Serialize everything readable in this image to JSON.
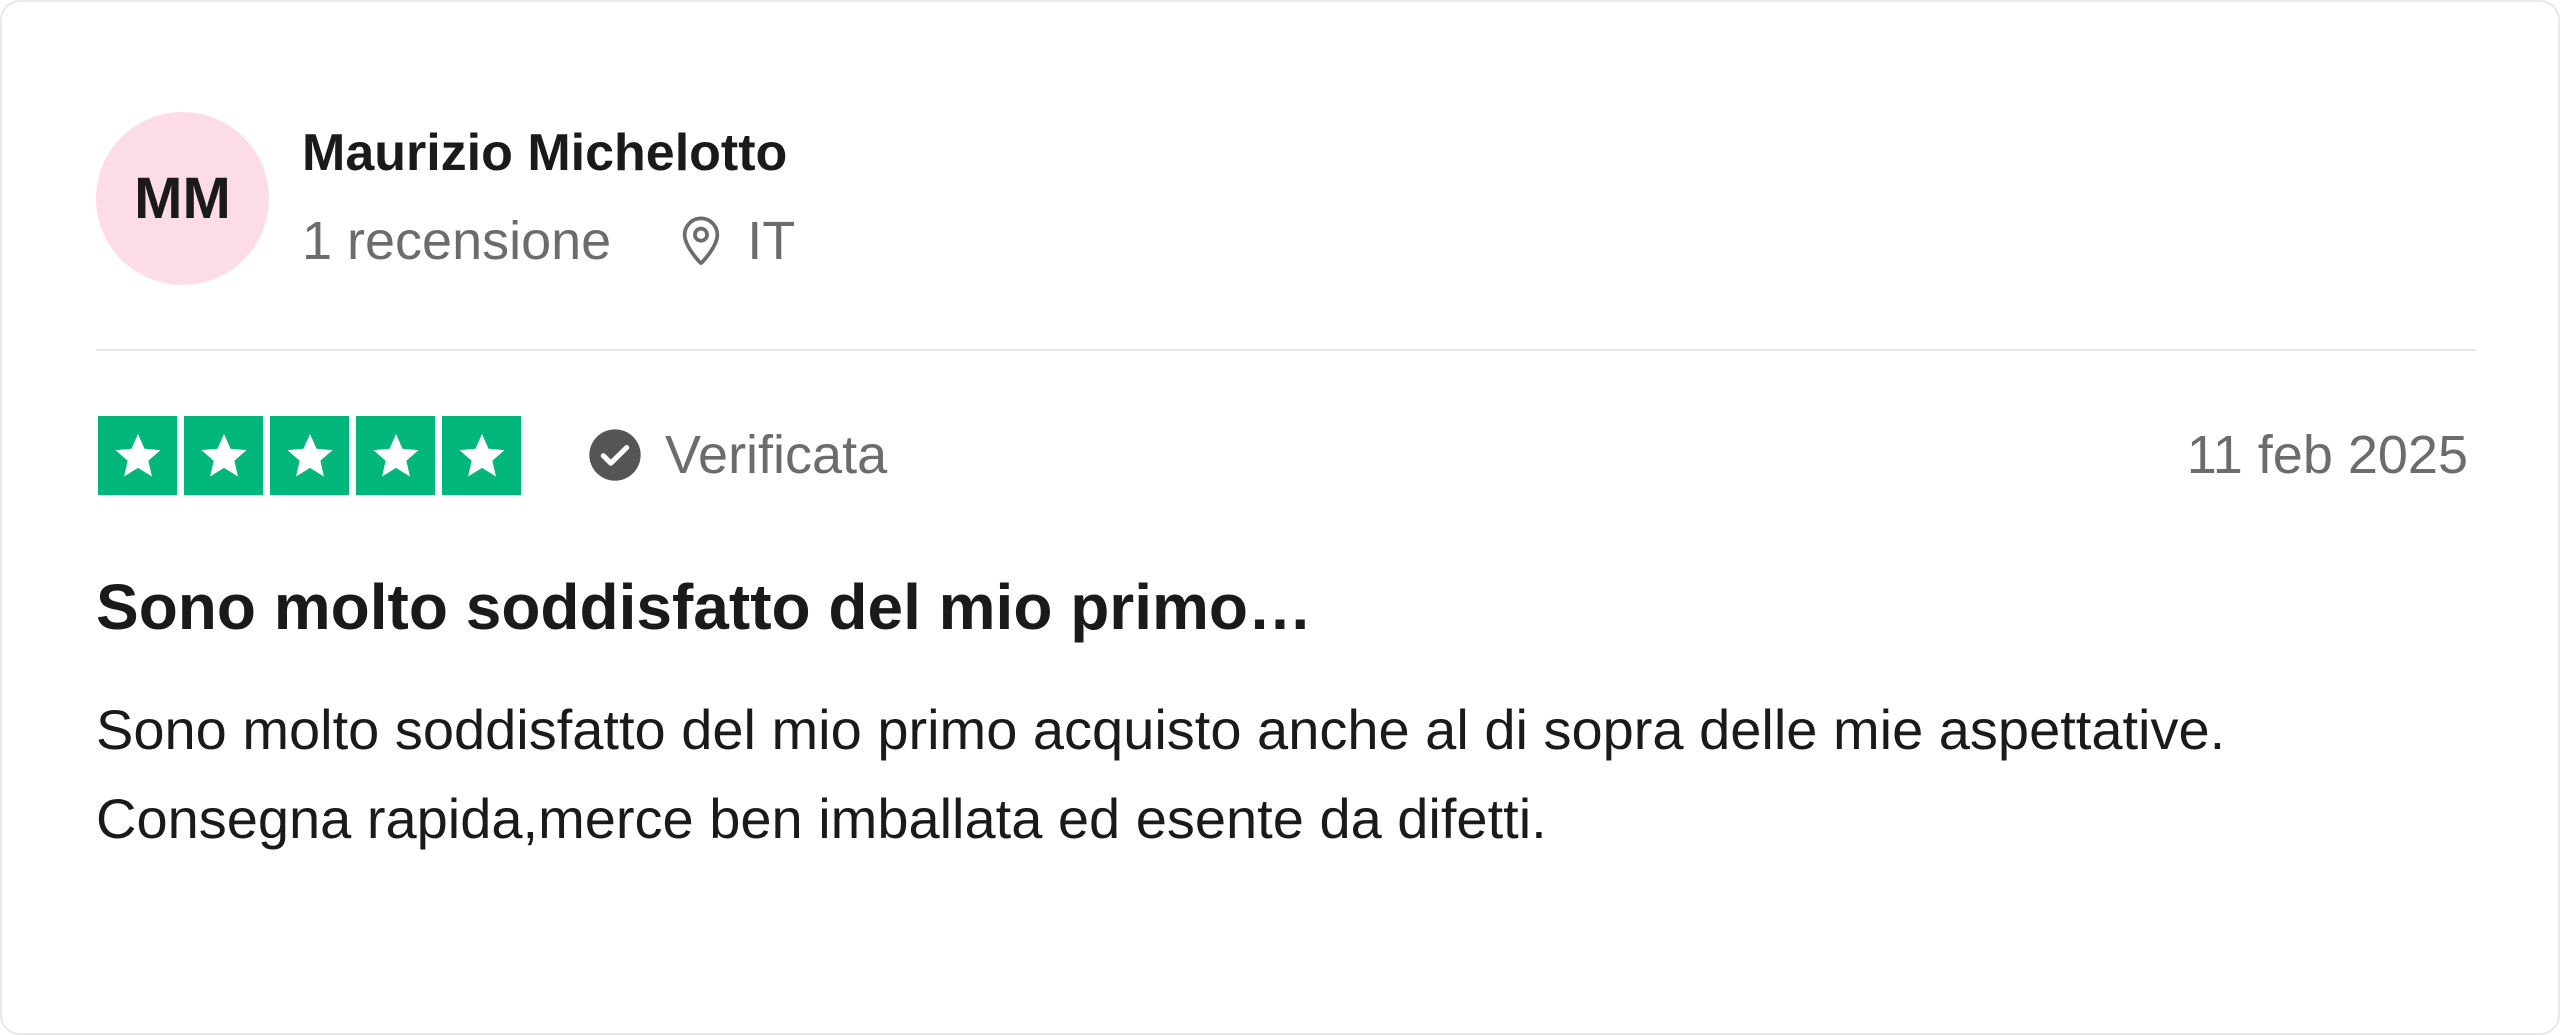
{
  "reviewer": {
    "initials": "MM",
    "name": "Maurizio Michelotto",
    "review_count": "1 recensione",
    "country": "IT",
    "avatar_color": "#fcdde6"
  },
  "review": {
    "rating": 5,
    "max_rating": 5,
    "star_color": "#00b67a",
    "verified_label": "Verificata",
    "date": "11 feb 2025",
    "title": "Sono molto soddisfatto del mio primo…",
    "body_lines": [
      "Sono molto soddisfatto del mio primo acquisto anche al di sopra delle mie aspettative.",
      "Consegna rapida,merce ben imballata ed esente da difetti."
    ]
  },
  "icons": {
    "location": "location-pin-icon",
    "verified": "check-circle-icon",
    "star": "star-icon"
  }
}
